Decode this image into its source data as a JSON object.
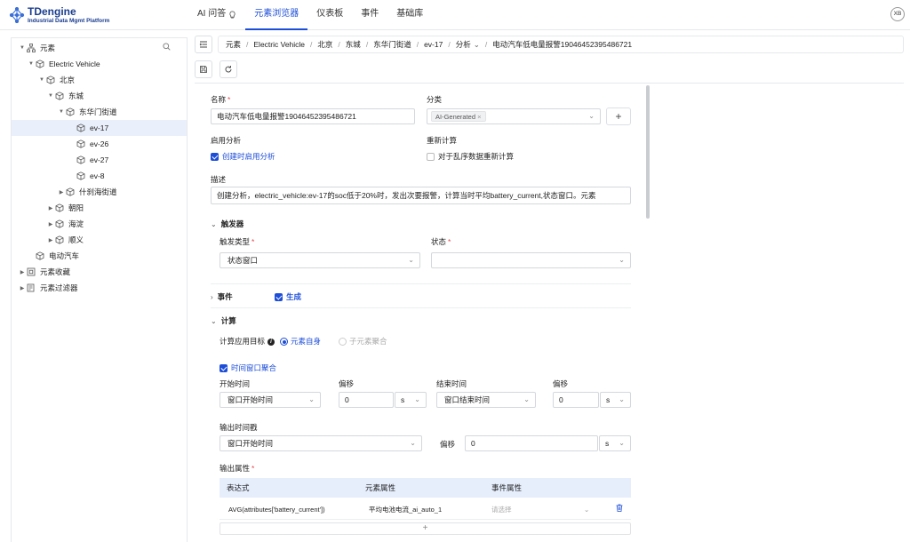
{
  "app": {
    "logo_title": "TDengine",
    "logo_subtitle": "Industrial Data Mgmt Platform",
    "user_initials": "XB"
  },
  "nav": [
    {
      "label": "AI 问答",
      "active": false
    },
    {
      "label": "元素浏览器",
      "active": true
    },
    {
      "label": "仪表板",
      "active": false
    },
    {
      "label": "事件",
      "active": false
    },
    {
      "label": "基础库",
      "active": false
    }
  ],
  "tree": {
    "root_label": "元素",
    "nodes": [
      {
        "label": "Electric Vehicle"
      },
      {
        "label": "北京"
      },
      {
        "label": "东城"
      },
      {
        "label": "东华门街道"
      },
      {
        "label": "ev-17"
      },
      {
        "label": "ev-26"
      },
      {
        "label": "ev-27"
      },
      {
        "label": "ev-8"
      },
      {
        "label": "什刹海街道"
      },
      {
        "label": "朝阳"
      },
      {
        "label": "海淀"
      },
      {
        "label": "顺义"
      },
      {
        "label": "电动汽车"
      },
      {
        "label": "元素收藏"
      },
      {
        "label": "元素过滤器"
      }
    ]
  },
  "breadcrumb": [
    "元素",
    "Electric Vehicle",
    "北京",
    "东城",
    "东华门街道",
    "ev-17",
    "分析",
    "电动汽车低电量报警190464523954867​21"
  ],
  "form": {
    "name_label": "名称",
    "name_value": "电动汽车低电量报警190464523954867​21",
    "category_label": "分类",
    "category_tag": "AI-Generated",
    "enable_label": "启用分析",
    "enable_option": "创建时启用分析",
    "recalc_label": "重新计算",
    "recalc_option": "对于乱序数据重新计算",
    "desc_label": "描述",
    "desc_value": "创建分析，electric_vehicle:ev-17的soc低于20%时，发出次要报警，计算当时平均battery_current,状态窗口。元素",
    "trigger_section": "触发器",
    "trigger_type_label": "触发类型",
    "trigger_type_value": "状态窗口",
    "state_label": "状态",
    "state_value": "",
    "event_section": "事件",
    "event_generate": "生成",
    "calc_section": "计算",
    "calc_target_label": "计算应用目标",
    "calc_target_self": "元素自身",
    "calc_target_child": "子元素聚合",
    "time_window_label": "时间窗口聚合",
    "start_time_label": "开始时间",
    "start_time_value": "窗口开始时间",
    "offset_label": "偏移",
    "offset1_value": "0",
    "offset1_unit": "s",
    "end_time_label": "结束时间",
    "end_time_value": "窗口结束时间",
    "offset2_value": "0",
    "offset2_unit": "s",
    "output_ts_label": "输出时间戳",
    "output_ts_value": "窗口开始时间",
    "output_offset_label": "偏移",
    "output_offset_value": "0",
    "output_offset_unit": "s",
    "output_attr_label": "输出属性",
    "table_headers": [
      "表达式",
      "元素属性",
      "事件属性"
    ],
    "table_rows": [
      {
        "expression": "AVG(attributes['battery_current'])",
        "element_attr": "平均电池电流_ai_auto_1",
        "event_attr_placeholder": "请选择"
      }
    ],
    "add_row": "+"
  },
  "colors": {
    "accent": "#1d4ed8",
    "required": "#e5484d",
    "table_header": "#e6eefc"
  }
}
